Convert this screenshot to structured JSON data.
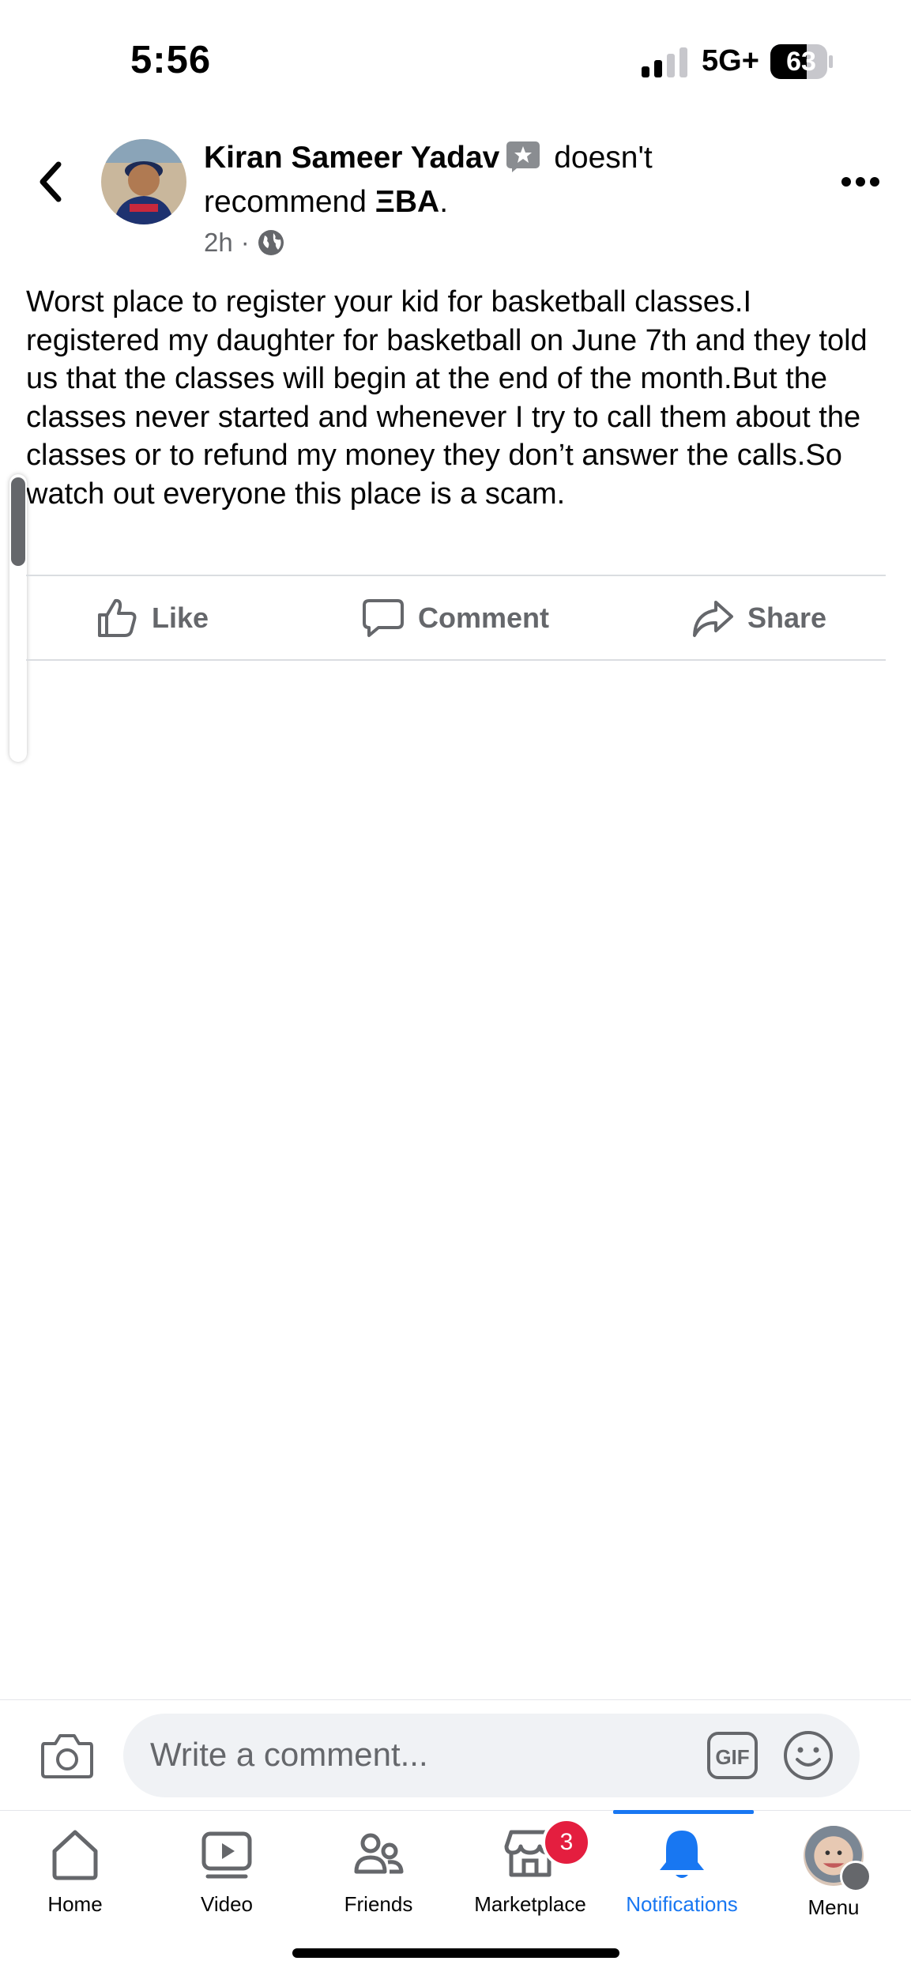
{
  "status_bar": {
    "time": "5:56",
    "network": "5G+",
    "battery": "63"
  },
  "post": {
    "author": "Kiran Sameer Yadav",
    "action": "doesn't recommend",
    "page": "ΞBA",
    "time": "2h",
    "audience_icon": "globe-icon",
    "text": "Worst place to register your kid for basketball classes.I registered my daughter for basketball on June 7th and they told us that the classes will begin at the end of the month.But the classes never started and whenever I try to call them about the classes or to refund my money they don’t answer the calls.So watch out everyone this place is a scam."
  },
  "actions": {
    "like": "Like",
    "comment": "Comment",
    "share": "Share"
  },
  "comment_bar": {
    "placeholder": "Write a comment...",
    "gif": "GIF"
  },
  "tabs": [
    {
      "label": "Home",
      "icon": "home-icon"
    },
    {
      "label": "Video",
      "icon": "video-icon"
    },
    {
      "label": "Friends",
      "icon": "friends-icon"
    },
    {
      "label": "Marketplace",
      "icon": "marketplace-icon",
      "badge": "3"
    },
    {
      "label": "Notifications",
      "icon": "bell-icon",
      "active": true
    },
    {
      "label": "Menu",
      "icon": "profile-avatar"
    }
  ],
  "colors": {
    "accent": "#1877f2",
    "badge": "#e41e3f",
    "secondary_text": "#65676b"
  }
}
